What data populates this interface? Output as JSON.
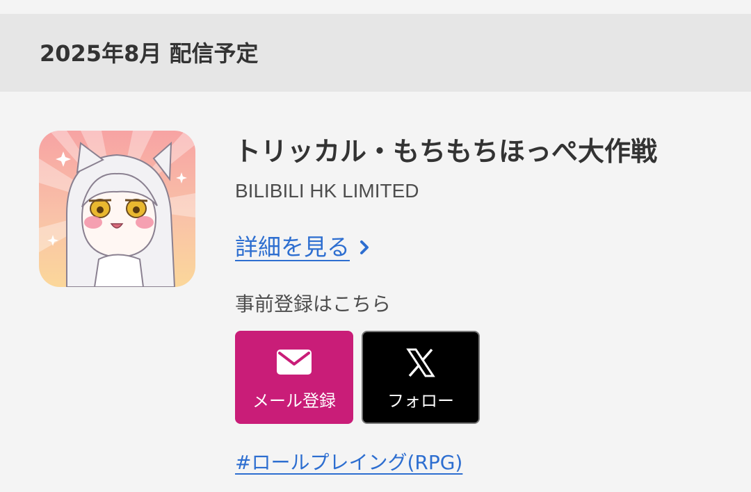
{
  "section": {
    "title": "2025年8月 配信予定"
  },
  "app": {
    "icon_name": "app-icon-character",
    "title": "トリッカル・もちもちほっぺ大作戦",
    "developer": "BILIBILI HK LIMITED",
    "details_label": "詳細を見る",
    "details_icon": "chevron-right-icon"
  },
  "preregister": {
    "label": "事前登録はこちら",
    "mail_button": {
      "icon": "envelope-icon",
      "label": "メール登録"
    },
    "x_button": {
      "icon": "x-logo-icon",
      "label": "フォロー"
    }
  },
  "genre": {
    "label": "#ロールプレイング(RPG)"
  },
  "colors": {
    "background": "#f4f4f4",
    "header_band": "#e6e6e6",
    "link_blue": "#2d6ed0",
    "mail_button": "#c91d78",
    "x_button": "#000000"
  }
}
